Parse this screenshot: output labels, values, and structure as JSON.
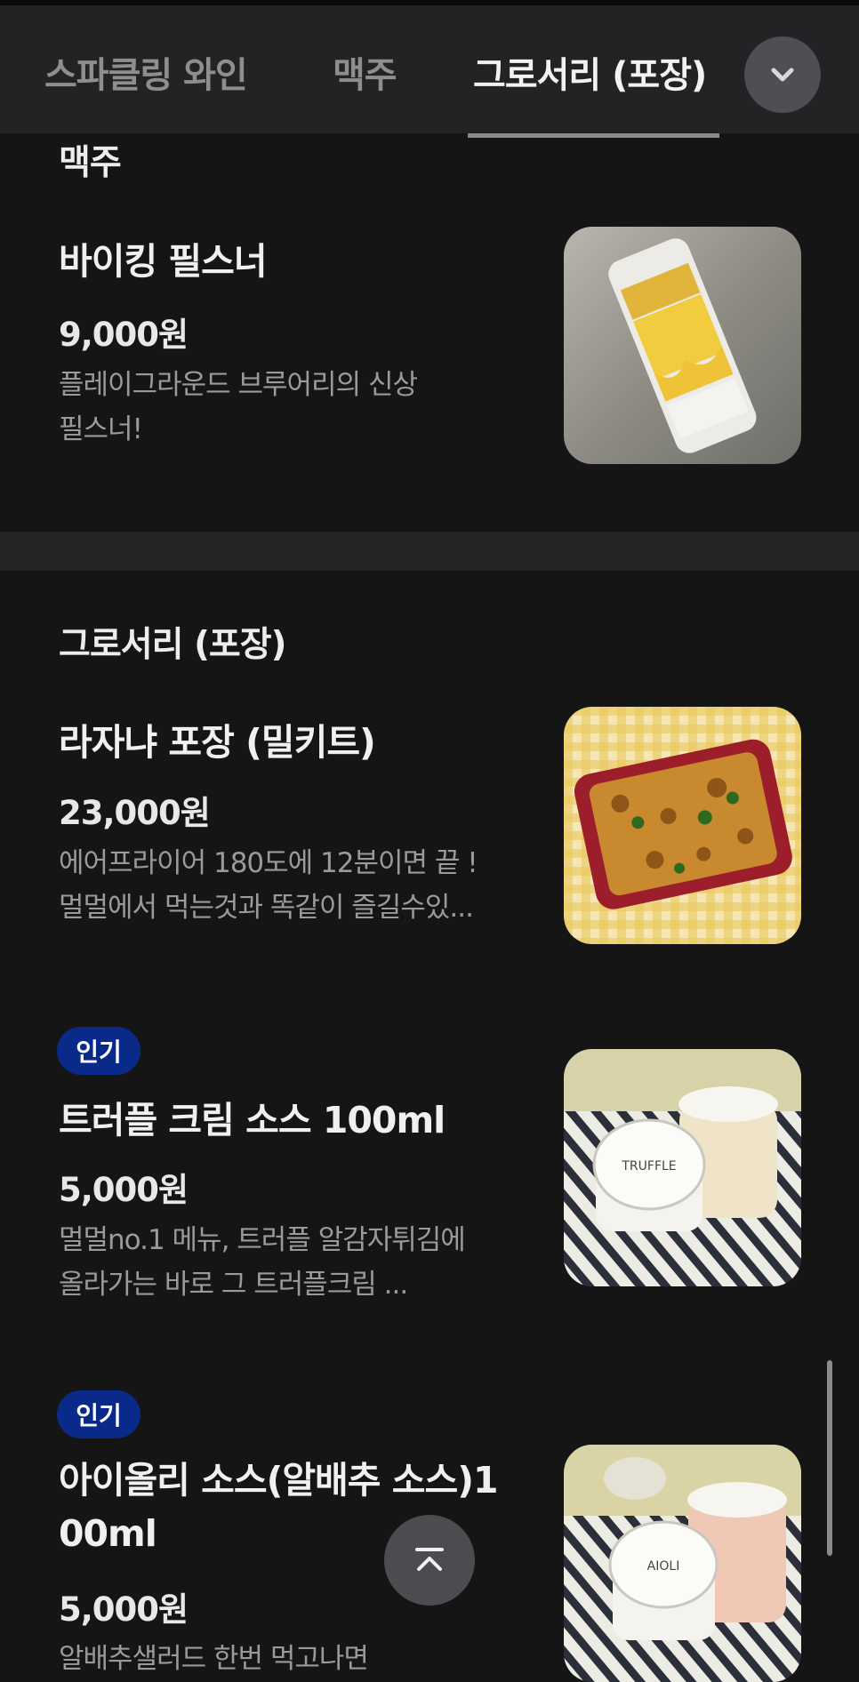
{
  "tabs": [
    {
      "label": "스파클링 와인",
      "active": false
    },
    {
      "label": "맥주",
      "active": false
    },
    {
      "label": "그로서리 (포장)",
      "active": true
    }
  ],
  "sections": {
    "beer": {
      "title": "맥주",
      "items": [
        {
          "name": "바이킹 필스너",
          "price": "9,000원",
          "desc_line1": "플레이그라운드 브루어리의 신상",
          "desc_line2": "필스너!",
          "image": "beer-can"
        }
      ]
    },
    "grocery": {
      "title": "그로서리 (포장)",
      "items": [
        {
          "name": "라자냐 포장 (밀키트)",
          "price": "23,000원",
          "desc_line1": "에어프라이어 180도에 12분이면 끝 !",
          "desc_line2": "멀멀에서 먹는것과 똑같이 즐길수있...",
          "image": "lasagna"
        },
        {
          "badge": "인기",
          "name": "트러플 크림 소스 100ml",
          "price": "5,000원",
          "desc_line1": "멀멀no.1 메뉴, 트러플 알감자튀김에",
          "desc_line2": "올라가는 바로 그 트러플크림 ...",
          "image": "sauce-cups"
        },
        {
          "badge": "인기",
          "name_line1": "아이올리 소스(알배추 소스)1",
          "name_line2": "00ml",
          "price": "5,000원",
          "desc_line1": "알배추샐러드 한번 먹고나면",
          "image": "sauce-cups-pink"
        }
      ]
    }
  },
  "icons": {
    "tab_chevron": "chevron-down-icon",
    "scroll_top": "arrow-up-to-top-icon"
  },
  "colors": {
    "background": "#151516",
    "tabbar": "#232325",
    "badge": "#0a2a8a"
  }
}
